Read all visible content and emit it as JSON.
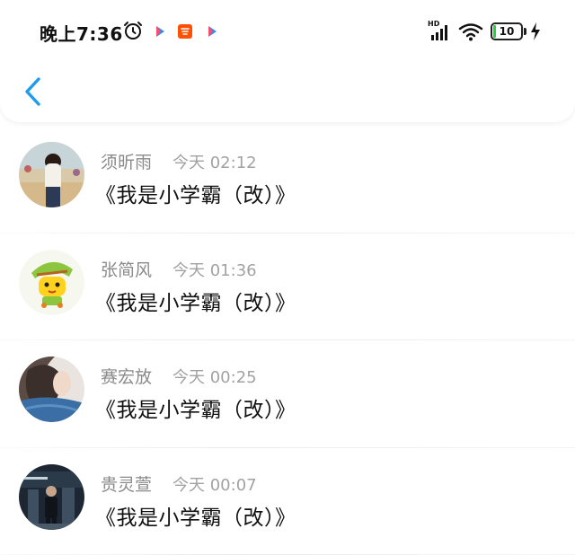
{
  "status_bar": {
    "time": "晚上7:36",
    "network": "HD",
    "battery": "10",
    "battery_percent": 10
  },
  "colors": {
    "accent": "#1e9bea",
    "name_text": "#8a8a8a",
    "message_text": "#111111",
    "battery_green": "#2ecc40"
  },
  "icons": {
    "back": "chevron-left-icon",
    "alarm": "alarm-clock-icon",
    "wifi": "wifi-icon",
    "signal": "signal-icon",
    "charging": "lightning-icon"
  },
  "messages": [
    {
      "name": "须昕雨",
      "time": "今天 02:12",
      "text": "《我是小学霸（改）》"
    },
    {
      "name": "张简风",
      "time": "今天 01:36",
      "text": "《我是小学霸（改）》"
    },
    {
      "name": "赛宏放",
      "time": "今天 00:25",
      "text": "《我是小学霸（改）》"
    },
    {
      "name": "贵灵萱",
      "time": "今天 00:07",
      "text": "《我是小学霸（改）》"
    }
  ]
}
